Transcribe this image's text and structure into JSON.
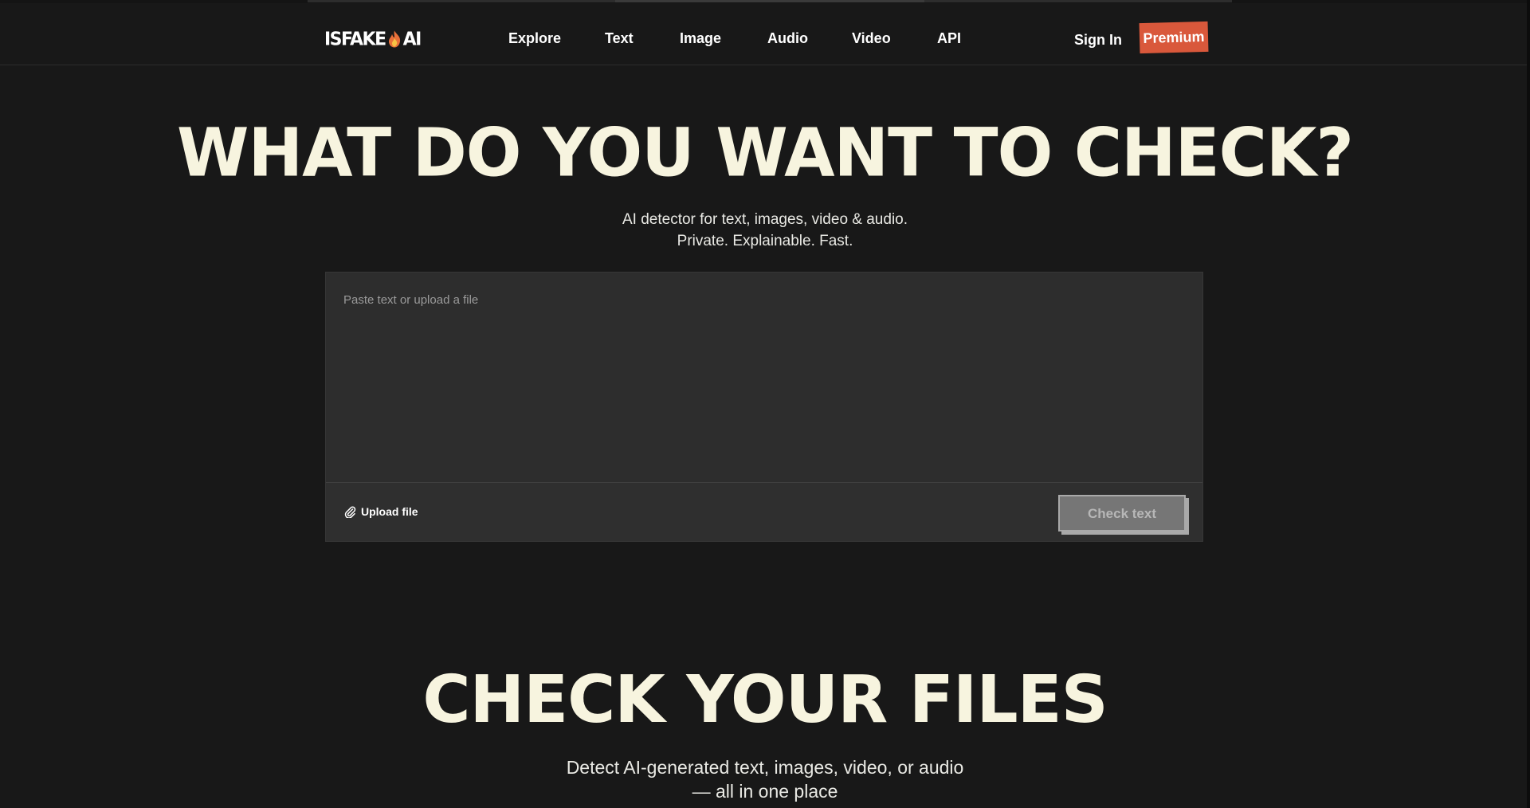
{
  "header": {
    "logo": {
      "left": "ISFAKE",
      "right": "AI"
    },
    "nav": [
      {
        "label": "Explore"
      },
      {
        "label": "Text"
      },
      {
        "label": "Image"
      },
      {
        "label": "Audio"
      },
      {
        "label": "Video"
      },
      {
        "label": "API"
      }
    ],
    "sign_in": "Sign In",
    "premium": "Premium"
  },
  "hero": {
    "title": "WHAT DO YOU WANT TO CHECK?",
    "subtitle_line1": "AI detector for text, images, video & audio.",
    "subtitle_line2": "Private. Explainable. Fast."
  },
  "input": {
    "placeholder": "Paste text or upload a file",
    "value": "",
    "upload_label": "Upload file",
    "check_label": "Check text"
  },
  "section": {
    "title": "CHECK YOUR FILES",
    "subtitle": "Detect AI-generated text, images, video, or audio — all in one place"
  },
  "colors": {
    "background": "#181818",
    "title": "#f7f4df",
    "accent": "#d9583b",
    "card": "#2d2d2d",
    "button_disabled": "#767676"
  }
}
